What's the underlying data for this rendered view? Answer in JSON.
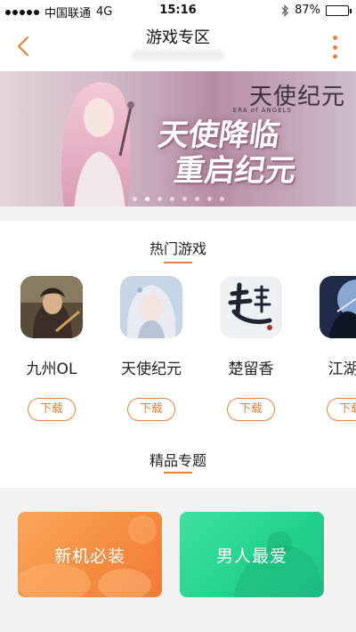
{
  "status_bar": {
    "carrier": "中国联通",
    "network": "4G",
    "time": "15:16",
    "battery": "87%",
    "battery_level": 0.87
  },
  "nav": {
    "title": "游戏专区",
    "back_icon": "chevron-left-icon",
    "more_icon": "more-vertical-icon"
  },
  "banner": {
    "logo": "天使纪元",
    "logo_sub": "ERA of ANGELS",
    "headline_line1": "天使降临",
    "headline_line2": "重启纪元",
    "slide_count": 8,
    "active_slide": 1
  },
  "hot_games": {
    "heading": "热门游戏",
    "download_label": "下载",
    "games": [
      {
        "name": "九州OL"
      },
      {
        "name": "天使纪元"
      },
      {
        "name": "楚留香"
      },
      {
        "name": "江湖笑"
      }
    ]
  },
  "featured": {
    "heading": "精品专题",
    "topics": [
      {
        "label": "新机必装"
      },
      {
        "label": "男人最爱"
      }
    ]
  },
  "colors": {
    "accent": "#e8833c",
    "topic_orange": "#f58b3e",
    "topic_green": "#22d08c"
  }
}
